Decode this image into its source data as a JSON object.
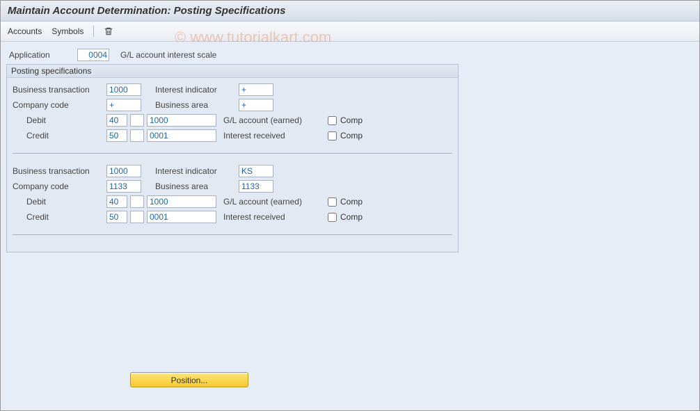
{
  "title": "Maintain Account Determination: Posting Specifications",
  "toolbar": {
    "accounts": "Accounts",
    "symbols": "Symbols",
    "delete_icon": "trash-icon"
  },
  "watermark": "© www.tutorialkart.com",
  "application": {
    "label": "Application",
    "value": "0004",
    "desc": "G/L account interest scale"
  },
  "group_title": "Posting specifications",
  "labels": {
    "bus_trans": "Business transaction",
    "int_ind": "Interest indicator",
    "comp_code": "Company code",
    "bus_area": "Business area",
    "debit": "Debit",
    "credit": "Credit",
    "gl_earned": "G/L account (earned)",
    "int_recv": "Interest received",
    "comp": "Comp"
  },
  "blocks": [
    {
      "bus_trans": "1000",
      "int_ind": "+",
      "comp_code": "+",
      "bus_area": "+",
      "debit_pk": "40",
      "debit_extra": "",
      "debit_acct": "1000",
      "debit_desc": "G/L account (earned)",
      "debit_comp": false,
      "credit_pk": "50",
      "credit_extra": "",
      "credit_acct": "0001",
      "credit_desc": "Interest received",
      "credit_comp": false
    },
    {
      "bus_trans": "1000",
      "int_ind": "KS",
      "comp_code": "1133",
      "bus_area": "1133",
      "debit_pk": "40",
      "debit_extra": "",
      "debit_acct": "1000",
      "debit_desc": "G/L account (earned)",
      "debit_comp": false,
      "credit_pk": "50",
      "credit_extra": "",
      "credit_acct": "0001",
      "credit_desc": "Interest received",
      "credit_comp": false
    }
  ],
  "position_button": "Position..."
}
